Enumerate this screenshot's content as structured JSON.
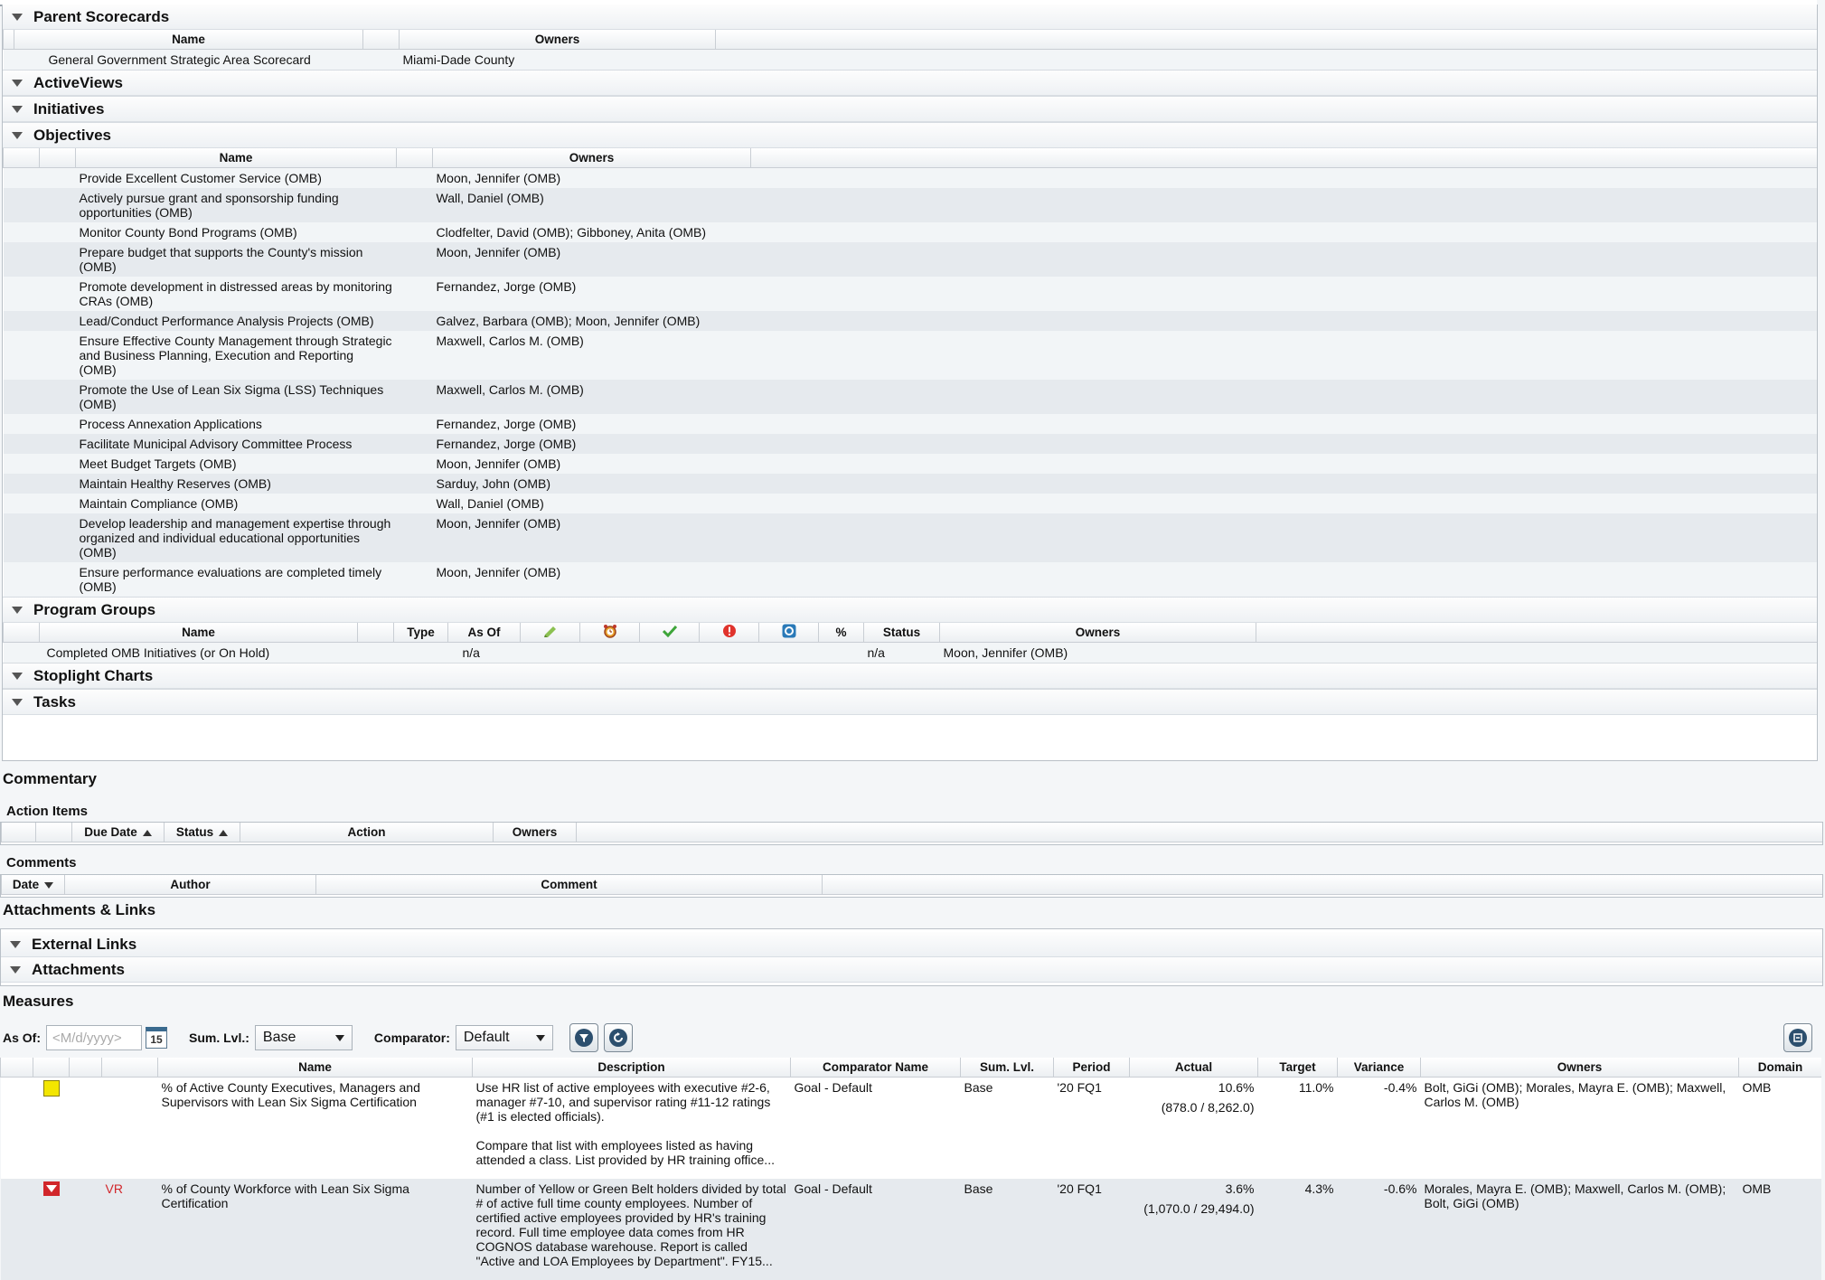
{
  "sections": {
    "parent_scorecards": {
      "title": "Parent Scorecards",
      "columns": [
        "Name",
        "Owners"
      ],
      "rows": [
        {
          "name": "General Government Strategic Area Scorecard",
          "owners": "Miami-Dade County"
        }
      ]
    },
    "active_views": {
      "title": "ActiveViews"
    },
    "initiatives": {
      "title": "Initiatives"
    },
    "objectives": {
      "title": "Objectives",
      "columns": [
        "Name",
        "Owners"
      ],
      "rows": [
        {
          "name": "Provide Excellent Customer Service (OMB)",
          "owners": "Moon, Jennifer (OMB)"
        },
        {
          "name": "Actively pursue grant and sponsorship funding opportunities (OMB)",
          "owners": "Wall, Daniel (OMB)"
        },
        {
          "name": "Monitor County Bond Programs (OMB)",
          "owners": "Clodfelter, David (OMB); Gibboney, Anita (OMB)"
        },
        {
          "name": "Prepare budget that supports the County's mission (OMB)",
          "owners": "Moon, Jennifer (OMB)"
        },
        {
          "name": "Promote development in distressed areas by monitoring CRAs (OMB)",
          "owners": "Fernandez, Jorge (OMB)"
        },
        {
          "name": "Lead/Conduct Performance Analysis Projects (OMB)",
          "owners": "Galvez, Barbara (OMB); Moon, Jennifer (OMB)"
        },
        {
          "name": "Ensure Effective County Management through Strategic and Business Planning, Execution and Reporting (OMB)",
          "owners": "Maxwell, Carlos M. (OMB)"
        },
        {
          "name": "Promote the Use of Lean Six Sigma (LSS) Techniques (OMB)",
          "owners": "Maxwell, Carlos M. (OMB)"
        },
        {
          "name": "Process Annexation Applications",
          "owners": "Fernandez, Jorge (OMB)"
        },
        {
          "name": "Facilitate Municipal Advisory Committee Process",
          "owners": "Fernandez, Jorge (OMB)"
        },
        {
          "name": "Meet Budget Targets (OMB)",
          "owners": "Moon, Jennifer (OMB)"
        },
        {
          "name": "Maintain Healthy Reserves (OMB)",
          "owners": "Sarduy, John (OMB)"
        },
        {
          "name": "Maintain Compliance (OMB)",
          "owners": "Wall, Daniel (OMB)"
        },
        {
          "name": "Develop leadership and management expertise through organized and individual educational opportunities (OMB)",
          "owners": "Moon, Jennifer (OMB)"
        },
        {
          "name": "Ensure performance evaluations are completed timely (OMB)",
          "owners": "Moon, Jennifer (OMB)"
        }
      ]
    },
    "program_groups": {
      "title": "Program Groups",
      "columns": {
        "name": "Name",
        "type": "Type",
        "as_of": "As Of",
        "pct": "%",
        "status": "Status",
        "owners": "Owners"
      },
      "rows": [
        {
          "name": "Completed OMB Initiatives (or On Hold)",
          "as_of": "n/a",
          "status": "n/a",
          "owners": "Moon, Jennifer (OMB)"
        }
      ]
    },
    "stoplight_charts": {
      "title": "Stoplight Charts"
    },
    "tasks": {
      "title": "Tasks"
    }
  },
  "commentary": {
    "title": "Commentary",
    "action_items": {
      "title": "Action Items",
      "columns": {
        "due_date": "Due Date",
        "status": "Status",
        "action": "Action",
        "owners": "Owners"
      }
    },
    "comments": {
      "title": "Comments",
      "columns": {
        "date": "Date",
        "author": "Author",
        "comment": "Comment"
      }
    }
  },
  "attachments_links": {
    "title": "Attachments & Links",
    "external_links": "External Links",
    "attachments": "Attachments"
  },
  "measures": {
    "title": "Measures",
    "toolbar": {
      "as_of_label": "As Of:",
      "as_of_placeholder": "<M/d/yyyy>",
      "calendar_day": "15",
      "sum_lvl_label": "Sum. Lvl.:",
      "sum_lvl_value": "Base",
      "comparator_label": "Comparator:",
      "comparator_value": "Default"
    },
    "columns": {
      "name": "Name",
      "description": "Description",
      "comparator": "Comparator Name",
      "sum_lvl": "Sum. Lvl.",
      "period": "Period",
      "actual": "Actual",
      "target": "Target",
      "variance": "Variance",
      "owners": "Owners",
      "domain": "Domain"
    },
    "rows": [
      {
        "status_color": "#f3e600",
        "code": "",
        "name": "% of Active County Executives, Managers and Supervisors with Lean Six Sigma Certification",
        "description1": "Use HR list of active employees with executive #2-6, manager #7-10, and supervisor rating #11-12 ratings (#1 is elected officials).",
        "description2": "Compare that list with employees listed as having attended a class.  List provided by HR training office...",
        "comparator": "Goal - Default",
        "sum_lvl": "Base",
        "period": "'20 FQ1",
        "actual": "10.6%",
        "actual_detail": "(878.0 / 8,262.0)",
        "target": "11.0%",
        "variance": "-0.4%",
        "owners": "Bolt, GiGi (OMB); Morales, Mayra E. (OMB); Maxwell, Carlos M. (OMB)",
        "domain": "OMB"
      },
      {
        "status_color": "#d1262a",
        "code": "VR",
        "name": "% of County Workforce with Lean Six Sigma Certification",
        "description1": "Number of Yellow or Green Belt holders divided by total # of active full time county employees.  Number of certified active employees provided by HR's training record.  Full time employee data comes from HR COGNOS database warehouse.  Report is called \"Active and LOA Employees by Department\".  FY15...",
        "description2": "",
        "comparator": "Goal - Default",
        "sum_lvl": "Base",
        "period": "'20 FQ1",
        "actual": "3.6%",
        "actual_detail": "(1,070.0 / 29,494.0)",
        "target": "4.3%",
        "variance": "-0.6%",
        "owners": "Morales, Mayra E. (OMB); Maxwell, Carlos M. (OMB); Bolt, GiGi (OMB)",
        "domain": "OMB"
      }
    ]
  }
}
